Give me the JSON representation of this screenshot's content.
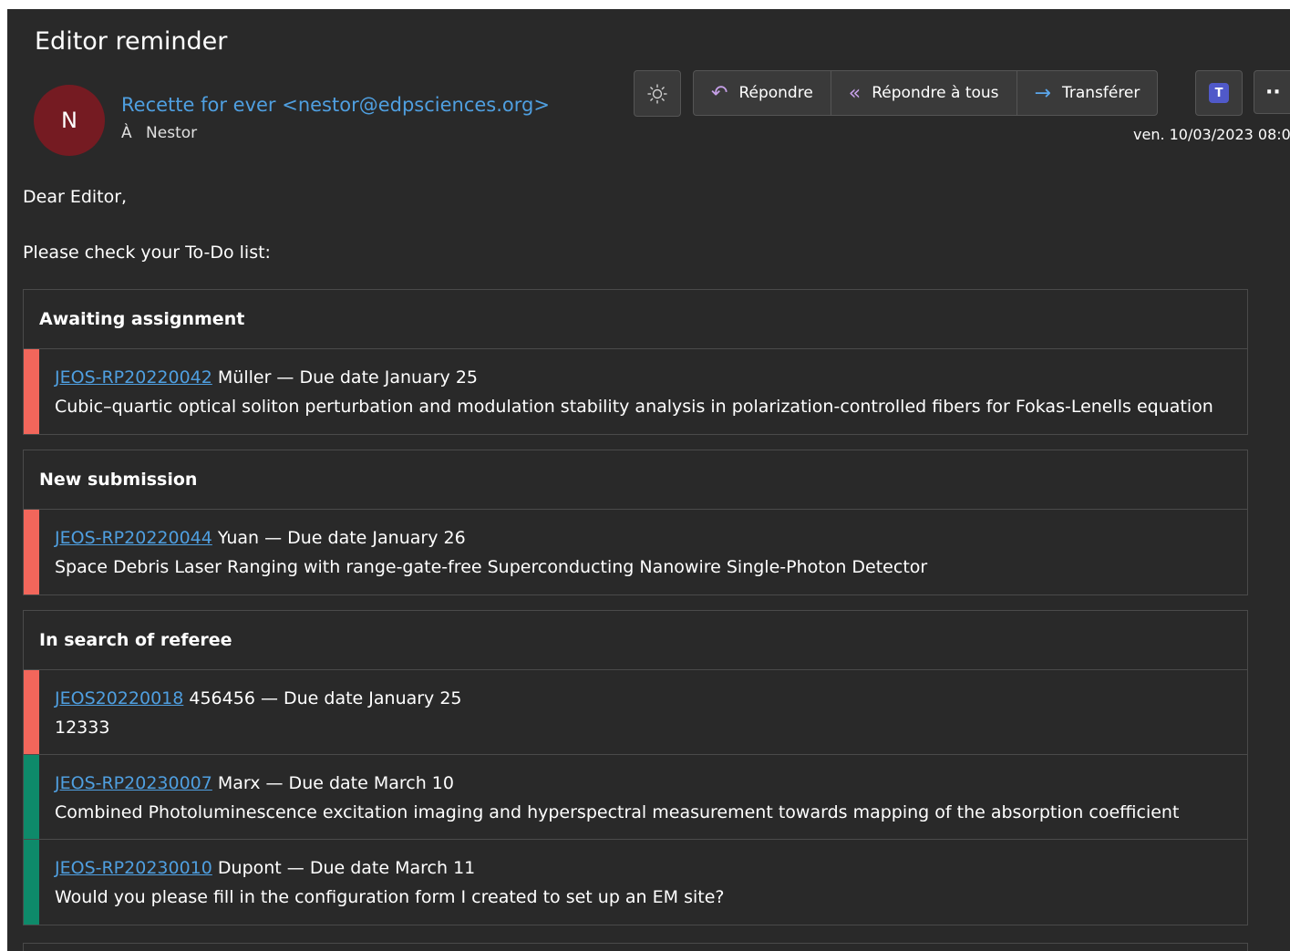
{
  "message": {
    "subject": "Editor reminder",
    "avatar_initial": "N",
    "sender": "Recette for ever <nestor@edpsciences.org>",
    "to_prefix": "À",
    "to_name": "Nestor",
    "date": "ven. 10/03/2023 08:0"
  },
  "toolbar": {
    "reply": "Répondre",
    "reply_all": "Répondre à tous",
    "forward": "Transférer",
    "teams_glyph": "T",
    "more": "··"
  },
  "body": {
    "greeting": "Dear Editor,",
    "intro": "Please check your To-Do list:"
  },
  "sections": [
    {
      "title": "Awaiting assignment",
      "items": [
        {
          "id": "JEOS-RP20220042",
          "rest": " Müller — Due date January 25",
          "desc": "Cubic–quartic optical soliton perturbation and modulation stability analysis in polarization-controlled fibers for Fokas-Lenells equation",
          "color": "#f2665b"
        }
      ]
    },
    {
      "title": "New submission",
      "items": [
        {
          "id": "JEOS-RP20220044",
          "rest": " Yuan — Due date January 26",
          "desc": "Space Debris Laser Ranging with range-gate-free Superconducting Nanowire Single-Photon Detector",
          "color": "#f2665b"
        }
      ]
    },
    {
      "title": "In search of referee",
      "items": [
        {
          "id": "JEOS20220018",
          "rest": " 456456 — Due date January 25",
          "desc": "12333",
          "color": "#f2665b"
        },
        {
          "id": "JEOS-RP20230007",
          "rest": " Marx — Due date March 10",
          "desc": "Combined Photoluminescence excitation imaging and hyperspectral measurement towards mapping of the absorption coefficient",
          "color": "#0e8a6a"
        },
        {
          "id": "JEOS-RP20230010",
          "rest": " Dupont — Due date March 11",
          "desc": "Would you please fill in the configuration form I created to set up an EM site?",
          "color": "#0e8a6a"
        }
      ]
    }
  ]
}
